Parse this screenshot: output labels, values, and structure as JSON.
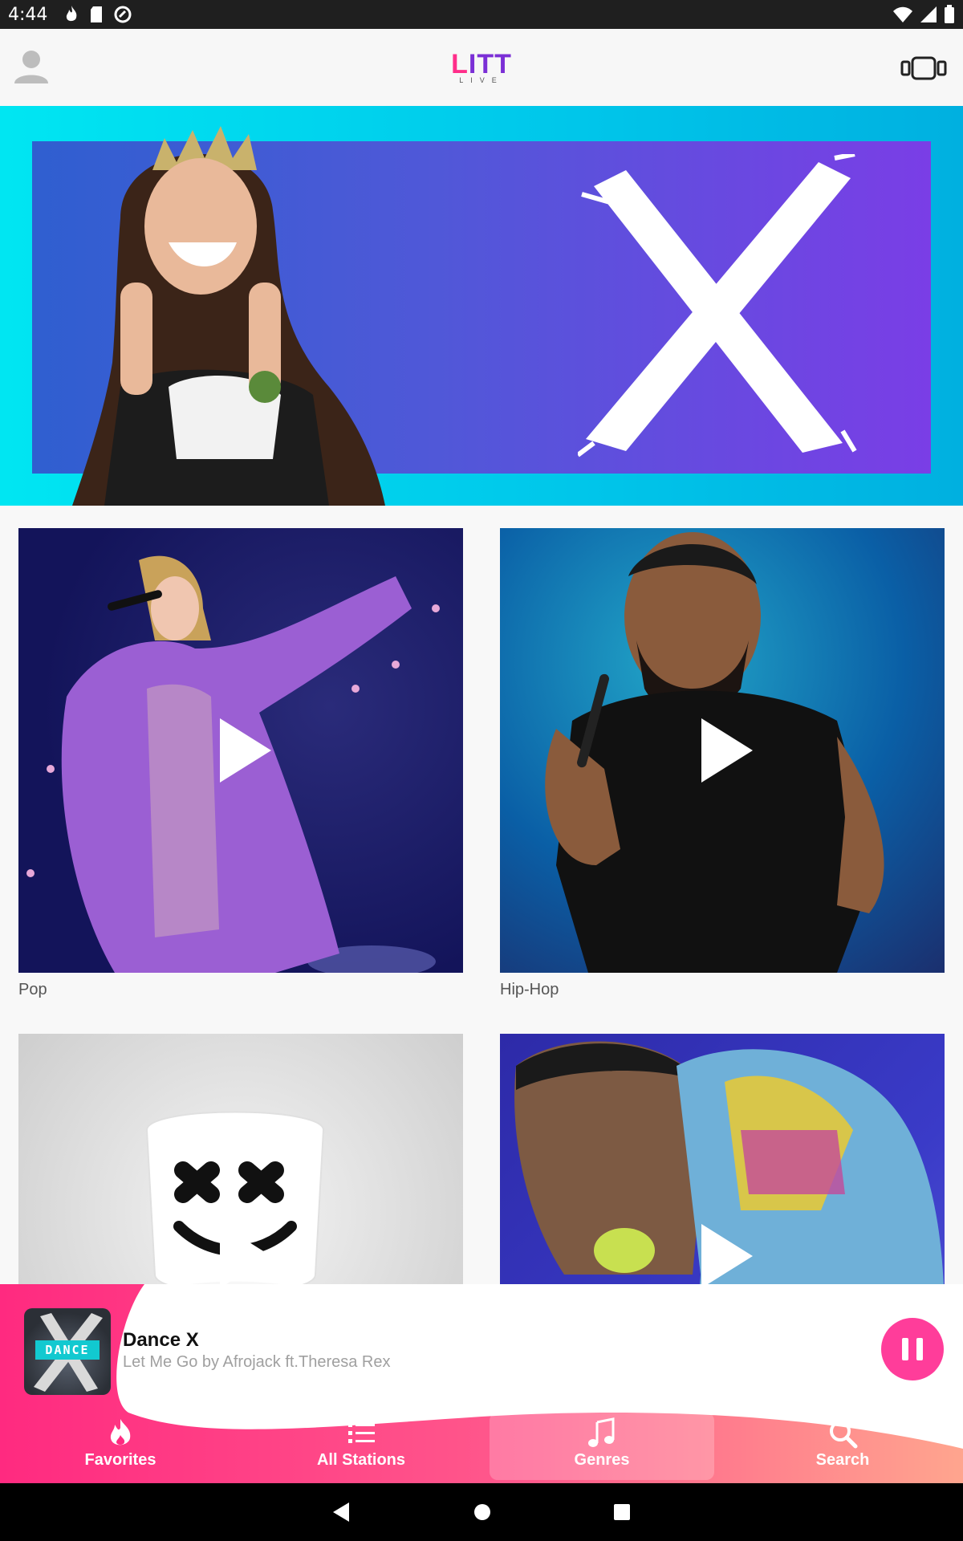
{
  "status_bar": {
    "time": "4:44"
  },
  "app": {
    "logo_main_l": "L",
    "logo_main_rest": "ITT",
    "logo_sub": "LIVE"
  },
  "genres": [
    {
      "label": "Pop"
    },
    {
      "label": "Hip-Hop"
    },
    {
      "label": ""
    },
    {
      "label": ""
    }
  ],
  "player": {
    "station": "Dance X",
    "now_playing": "Let Me Go by Afrojack ft.Theresa Rex",
    "art_text": "DANCE",
    "state": "playing"
  },
  "nav": {
    "items": [
      {
        "label": "Favorites",
        "icon": "flame-icon",
        "active": false
      },
      {
        "label": "All Stations",
        "icon": "list-icon",
        "active": false
      },
      {
        "label": "Genres",
        "icon": "music-note-icon",
        "active": true
      },
      {
        "label": "Search",
        "icon": "search-icon",
        "active": false
      }
    ]
  },
  "colors": {
    "accent": "#ff3d9a",
    "brand_purple": "#7b2fd6",
    "banner_cyan": "#00e6f2"
  }
}
